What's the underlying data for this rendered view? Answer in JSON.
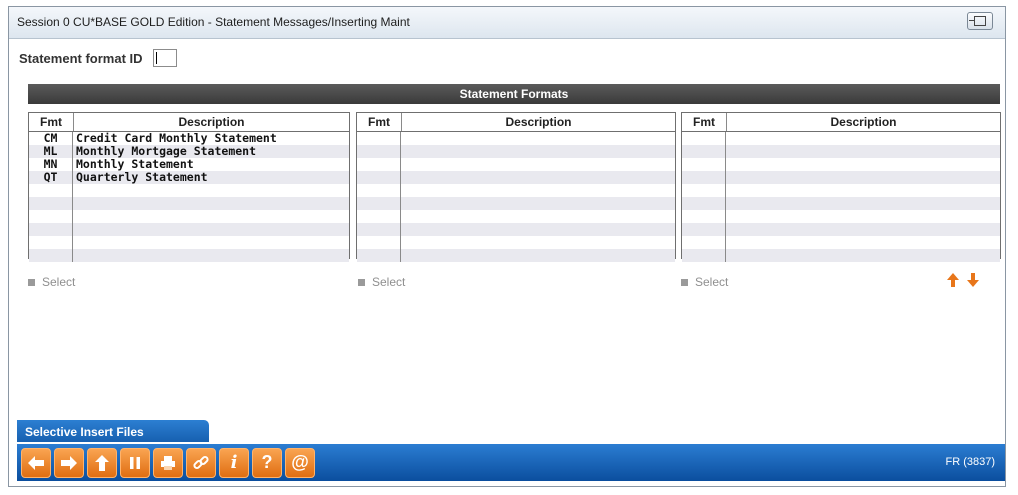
{
  "window": {
    "title": "Session 0 CU*BASE GOLD Edition - Statement Messages/Inserting Maint"
  },
  "form": {
    "fmt_label": "Statement format ID",
    "fmt_value": ""
  },
  "section": {
    "title": "Statement Formats"
  },
  "columns": {
    "fmt": "Fmt",
    "description": "Description"
  },
  "panels": [
    {
      "rows": [
        {
          "fmt": "CM",
          "desc": "Credit Card Monthly Statement"
        },
        {
          "fmt": "ML",
          "desc": "Monthly Mortgage Statement"
        },
        {
          "fmt": "MN",
          "desc": "Monthly Statement"
        },
        {
          "fmt": "QT",
          "desc": "Quarterly Statement"
        },
        {
          "fmt": "",
          "desc": ""
        },
        {
          "fmt": "",
          "desc": ""
        },
        {
          "fmt": "",
          "desc": ""
        },
        {
          "fmt": "",
          "desc": ""
        },
        {
          "fmt": "",
          "desc": ""
        },
        {
          "fmt": "",
          "desc": ""
        }
      ]
    },
    {
      "rows": [
        {
          "fmt": "",
          "desc": ""
        },
        {
          "fmt": "",
          "desc": ""
        },
        {
          "fmt": "",
          "desc": ""
        },
        {
          "fmt": "",
          "desc": ""
        },
        {
          "fmt": "",
          "desc": ""
        },
        {
          "fmt": "",
          "desc": ""
        },
        {
          "fmt": "",
          "desc": ""
        },
        {
          "fmt": "",
          "desc": ""
        },
        {
          "fmt": "",
          "desc": ""
        },
        {
          "fmt": "",
          "desc": ""
        }
      ]
    },
    {
      "rows": [
        {
          "fmt": "",
          "desc": ""
        },
        {
          "fmt": "",
          "desc": ""
        },
        {
          "fmt": "",
          "desc": ""
        },
        {
          "fmt": "",
          "desc": ""
        },
        {
          "fmt": "",
          "desc": ""
        },
        {
          "fmt": "",
          "desc": ""
        },
        {
          "fmt": "",
          "desc": ""
        },
        {
          "fmt": "",
          "desc": ""
        },
        {
          "fmt": "",
          "desc": ""
        },
        {
          "fmt": "",
          "desc": ""
        }
      ]
    }
  ],
  "actions": {
    "select_1": "Select",
    "select_2": "Select",
    "select_3": "Select"
  },
  "tab": {
    "label": "Selective Insert Files"
  },
  "toolbar": {
    "icons": [
      "back-arrow-icon",
      "forward-arrow-icon",
      "up-arrow-icon",
      "pause-icon",
      "printer-icon",
      "link-icon",
      "info-icon",
      "help-icon",
      "at-sign-icon"
    ],
    "info_glyph": "i",
    "help_glyph": "?",
    "at_glyph": "@",
    "screen_code": "FR (3837)"
  },
  "colors": {
    "accent_orange": "#e8761a",
    "toolbar_blue": "#1a66ba",
    "header_gray": "#4a4a4a"
  }
}
